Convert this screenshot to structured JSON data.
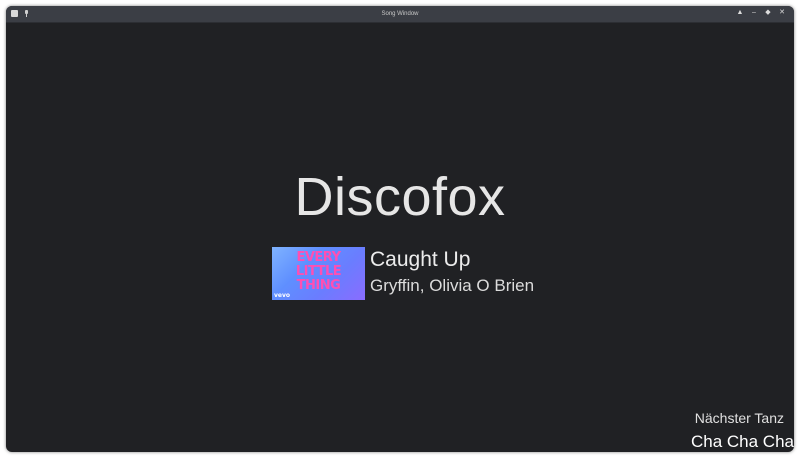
{
  "window": {
    "title": "Song Window"
  },
  "icons": {
    "app": "app-icon",
    "pin": "pin-icon",
    "keep_above": "chevron-up-icon",
    "minimize": "minimize-icon",
    "maximize": "maximize-icon",
    "close": "close-icon"
  },
  "titlebar_buttons": {
    "keep_above": "▲",
    "minimize": "–",
    "maximize": "◆",
    "close": "✕"
  },
  "current": {
    "dance": "Discofox",
    "song_title": "Caught Up",
    "song_artist": "Gryffin, Olivia O Brien",
    "cover_text": [
      "EVERY",
      "LITTLE",
      "THING"
    ],
    "cover_badge": "vevo"
  },
  "next": {
    "label": "Nächster Tanz",
    "dance": "Cha Cha Cha"
  },
  "colors": {
    "background": "#202124",
    "titlebar": "#3b3e45",
    "text": "#e6e6e6"
  }
}
